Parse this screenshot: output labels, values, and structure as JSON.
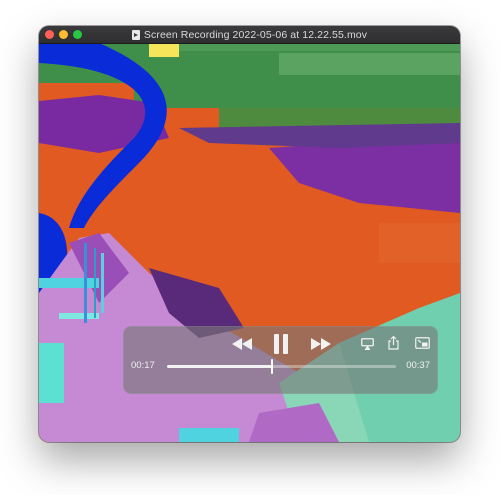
{
  "window": {
    "title": "Screen Recording 2022-05-06 at 12.22.55.mov"
  },
  "player": {
    "current_time": "00:17",
    "total_time": "00:37",
    "progress": 0.46
  },
  "colors": {
    "orange": "#e05a22",
    "blue": "#0a2bd8",
    "purple": "#7a2aa0",
    "green": "#3f8f4a",
    "mint": "#6fcfae",
    "lavender": "#c58ad3",
    "yellow": "#f4e55a"
  },
  "icons": {
    "rewind": "rewind-icon",
    "pause": "pause-icon",
    "forward": "fast-forward-icon",
    "airplay": "airplay-icon",
    "share": "share-icon",
    "pip": "picture-in-picture-icon",
    "doc": "document-icon"
  }
}
